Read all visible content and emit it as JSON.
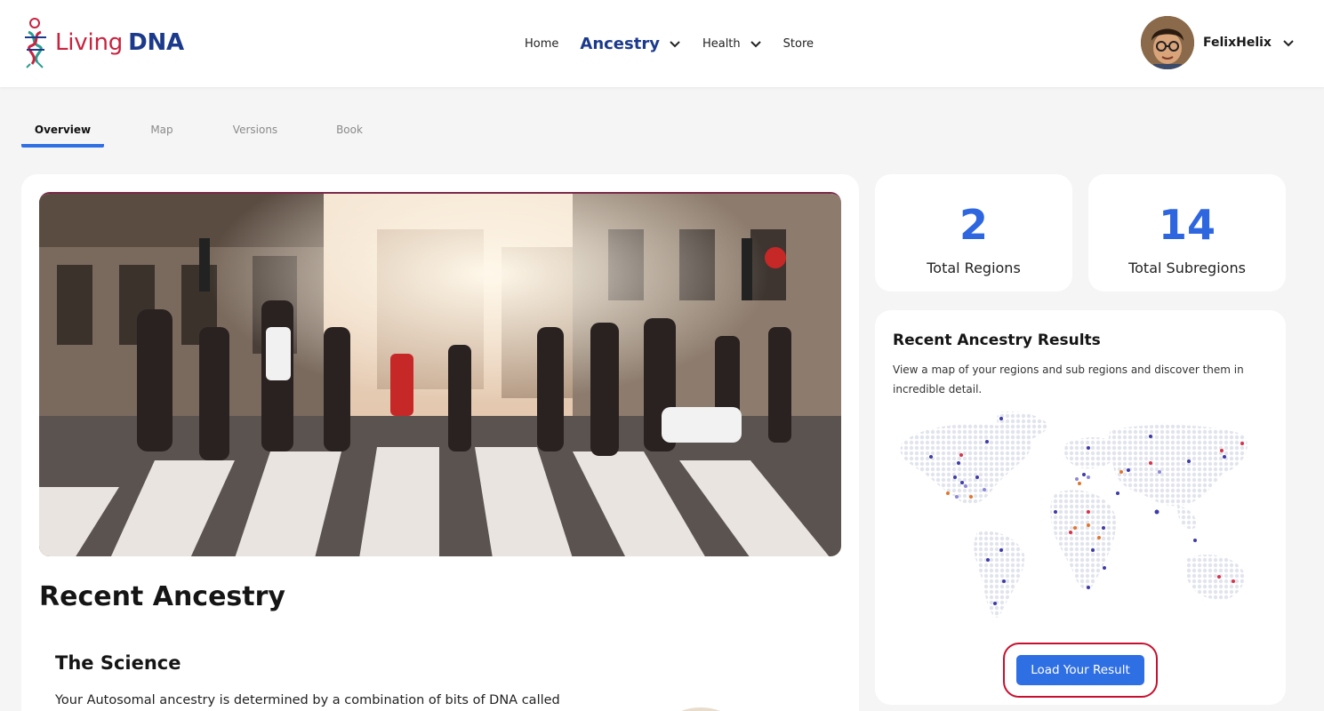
{
  "header": {
    "logo": {
      "part1": "Living",
      "part2": "DNA"
    },
    "nav": [
      {
        "label": "Home"
      },
      {
        "label": "Ancestry"
      },
      {
        "label": "Health"
      },
      {
        "label": "Store"
      }
    ],
    "user": {
      "name": "FelixHelix"
    }
  },
  "tabs": [
    {
      "label": "Overview",
      "active": true
    },
    {
      "label": "Map",
      "active": false
    },
    {
      "label": "Versions",
      "active": false
    },
    {
      "label": "Book",
      "active": false
    }
  ],
  "main": {
    "title": "Recent Ancestry",
    "subtitle": "The Science",
    "body": "Your Autosomal ancestry is determined by a combination of bits of DNA called"
  },
  "stats": [
    {
      "value": "2",
      "label": "Total Regions"
    },
    {
      "value": "14",
      "label": "Total Subregions"
    }
  ],
  "results": {
    "title": "Recent Ancestry Results",
    "description": "View a map of your regions and sub regions and discover them in incredible detail.",
    "button_label": "Load Your Result"
  },
  "colors": {
    "accent": "#2f6fe4",
    "brand_red": "#c8233f",
    "brand_navy": "#1b3a8c",
    "highlight_ring": "#c8102e"
  }
}
